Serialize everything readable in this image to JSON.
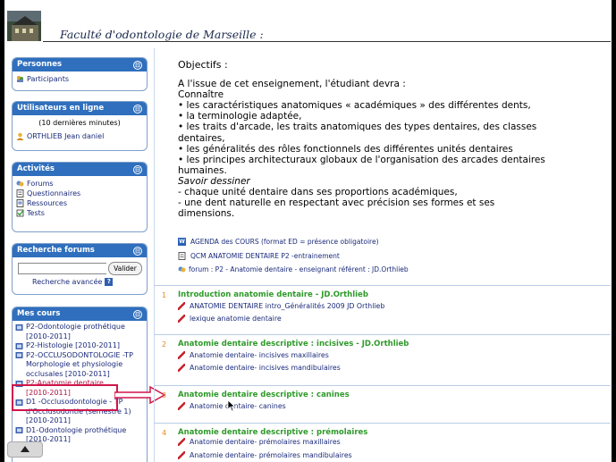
{
  "header": {
    "title": "Faculté d'odontologie de Marseille :"
  },
  "sidebar": {
    "personnes": {
      "title": "Personnes",
      "items": [
        "Participants"
      ]
    },
    "utilisateurs": {
      "title": "Utilisateurs en ligne",
      "subtitle": "(10 dernières minutes)",
      "user": "ORTHLIEB Jean daniel"
    },
    "activites": {
      "title": "Activités",
      "items": [
        "Forums",
        "Questionnaires",
        "Ressources",
        "Tests"
      ]
    },
    "recherche": {
      "title": "Recherche forums",
      "button": "Valider",
      "advanced": "Recherche avancée"
    },
    "cours": {
      "title": "Mes cours",
      "items": [
        "P2-Odontologie prothétique",
        "[2010-2011]",
        "P2-Histologie [2010-2011]",
        "P2-OCCLUSODONTOLOGIE -TP",
        "Morphologie et physiologie",
        "occlusales [2010-2011]",
        "P2-Anatomie dentaire",
        "[2010-2011]",
        "D1 -Occlusodontologie - TP",
        "d'Occlusodontie (semestre 1)",
        "[2010-2011]",
        "D1-Odontologie prothétique",
        "[2010-2011]"
      ]
    }
  },
  "objectifs": {
    "heading": "Objectifs :",
    "lines": [
      "A l'issue de cet enseignement, l'étudiant devra :",
      "Connaître",
      "• les caractéristiques anatomiques « académiques » des différentes dents,",
      "• la terminologie adaptée,",
      "• les traits d'arcade, les traits anatomiques des types dentaires, des classes",
      "dentaires,",
      "• les généralités des rôles fonctionnels des différentes unités dentaires",
      "• les principes architecturaux globaux de l'organisation des arcades dentaires",
      "humaines.",
      "Savoir dessiner",
      "- chaque unité dentaire dans ses proportions académiques,",
      "- une dent naturelle en respectant avec précision ses formes et ses",
      "dimensions."
    ],
    "links": [
      "AGENDA des COURS (format ED = présence obligatoire)",
      "QCM ANATOMIE DENTAIRE P2 -entrainement",
      "forum : P2 - Anatomie dentaire - enseignant référent : JD.Orthlieb"
    ]
  },
  "sections": [
    {
      "num": "1",
      "title": "Introduction anatomie dentaire - JD.Orthlieb",
      "items": [
        "ANATOMIE DENTAIRE intro_Généralités 2009 JD Orthlieb",
        "lexique anatomie dentaire"
      ]
    },
    {
      "num": "2",
      "title": "Anatomie dentaire descriptive : incisives - JD.Orthlieb",
      "items": [
        "Anatomie dentaire- incisives maxillaires",
        "Anatomie dentaire- incisives mandibulaires"
      ]
    },
    {
      "num": "3",
      "title": "Anatomie dentaire descriptive : canines",
      "items": [
        "Anatomie dentaire- canines"
      ]
    },
    {
      "num": "4",
      "title": "Anatomie dentaire descriptive : prémolaires",
      "items": [
        "Anatomie dentaire- prémolaires maxillaires",
        "Anatomie dentaire- prémolaires mandibulaires"
      ]
    }
  ]
}
